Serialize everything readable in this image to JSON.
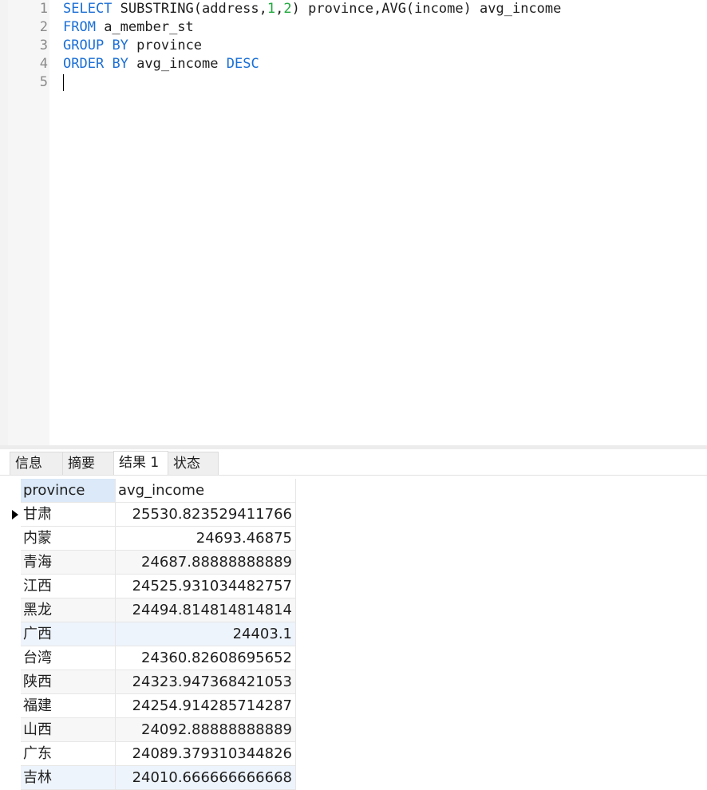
{
  "editor": {
    "line_numbers": [
      "1",
      "2",
      "3",
      "4",
      "5"
    ],
    "line1": {
      "kw_select": "SELECT",
      "text_a": " SUBSTRING(address,",
      "num_1": "1",
      "comma": ",",
      "num_2": "2",
      "text_b": ") province,AVG(income) avg_income"
    },
    "line2": {
      "kw_from": "FROM",
      "text": " a_member_st"
    },
    "line3": {
      "kw_group": "GROUP",
      "space": " ",
      "kw_by": "BY",
      "text": " province"
    },
    "line4": {
      "kw_order": "ORDER",
      "space": " ",
      "kw_by": "BY",
      "text": " avg_income ",
      "kw_desc": "DESC"
    }
  },
  "tabs": [
    "信息",
    "摘要",
    "结果 1",
    "状态"
  ],
  "active_tab": "结果 1",
  "grid": {
    "columns": [
      "province",
      "avg_income"
    ],
    "rows": [
      {
        "province": "甘肃",
        "avg_income": "25530.823529411766"
      },
      {
        "province": "内蒙",
        "avg_income": "24693.46875"
      },
      {
        "province": "青海",
        "avg_income": "24687.88888888889"
      },
      {
        "province": "江西",
        "avg_income": "24525.931034482757"
      },
      {
        "province": "黑龙",
        "avg_income": "24494.814814814814"
      },
      {
        "province": "广西",
        "avg_income": "24403.1"
      },
      {
        "province": "台湾",
        "avg_income": "24360.82608695652"
      },
      {
        "province": "陕西",
        "avg_income": "24323.947368421053"
      },
      {
        "province": "福建",
        "avg_income": "24254.914285714287"
      },
      {
        "province": "山西",
        "avg_income": "24092.88888888889"
      },
      {
        "province": "广东",
        "avg_income": "24089.379310344826"
      },
      {
        "province": "吉林",
        "avg_income": "24010.666666666668"
      }
    ]
  },
  "colors": {
    "keyword": "#1a6fd6",
    "number": "#1fa83c",
    "header_selected": "#dbe9f8"
  }
}
